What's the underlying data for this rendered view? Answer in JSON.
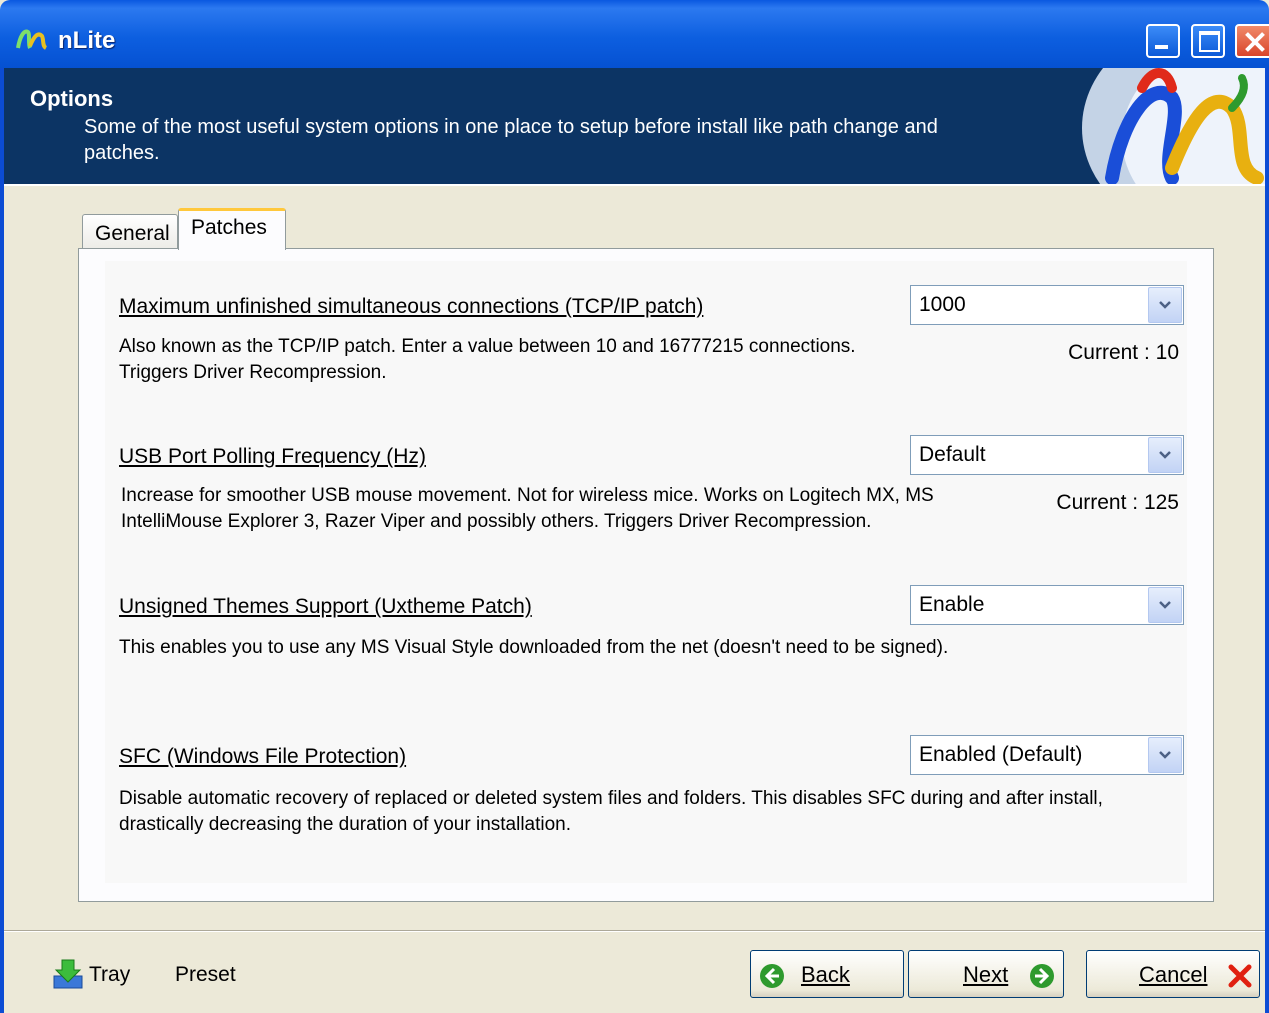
{
  "window": {
    "title": "nLite"
  },
  "header": {
    "title": "Options",
    "description": "Some of the most useful system options in one place to setup before install like path change and patches."
  },
  "tabs": [
    {
      "label": "General"
    },
    {
      "label": "Patches"
    }
  ],
  "active_tab": "Patches",
  "options": [
    {
      "title": "Maximum unfinished simultaneous connections (TCP/IP patch)",
      "description": "Also known as the TCP/IP patch. Enter a value between 10 and 16777215 connections. Triggers Driver Recompression.",
      "value": "1000",
      "current": "Current : 10"
    },
    {
      "title": "USB Port Polling Frequency (Hz)",
      "description": "Increase for smoother USB mouse movement. Not for wireless mice. Works on Logitech MX, MS IntelliMouse Explorer 3, Razer Viper and possibly others. Triggers Driver Recompression.",
      "value": "Default",
      "current": "Current : 125"
    },
    {
      "title": "Unsigned Themes Support (Uxtheme Patch)",
      "description": "This enables you to use any MS Visual Style downloaded from the net (doesn't need to be signed).",
      "value": "Enable"
    },
    {
      "title": "SFC (Windows File Protection)",
      "description": "Disable automatic recovery of replaced or deleted system files and folders. This disables SFC during and after install, drastically decreasing the duration of your installation.",
      "value": "Enabled (Default)"
    }
  ],
  "footer": {
    "tray_label": "Tray",
    "preset_label": "Preset",
    "back_label": "Back",
    "next_label": "Next",
    "cancel_label": "Cancel"
  },
  "icons": {
    "app": "nlite-logo-icon",
    "tray": "tray-arrow-icon",
    "back": "back-arrow-icon",
    "next": "next-arrow-icon",
    "cancel": "cancel-x-icon"
  },
  "colors": {
    "titlebar": "#0a58e0",
    "header_bg": "#0c3464",
    "tab_highlight": "#ffc83c",
    "arrow_green": "#2e9a2e",
    "cancel_red": "#e02010"
  }
}
